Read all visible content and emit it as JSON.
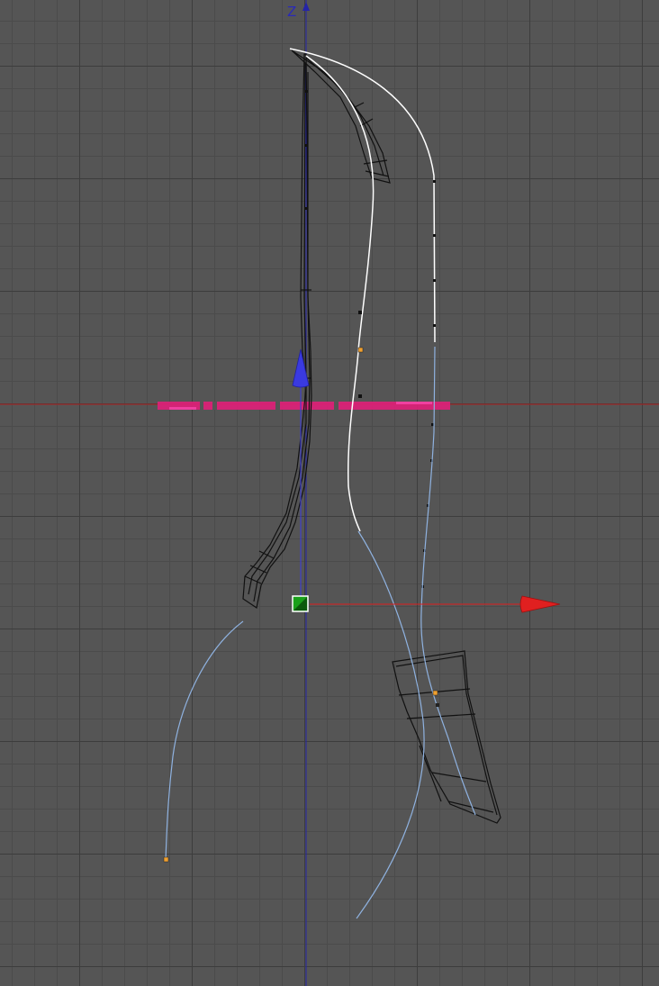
{
  "viewport": {
    "vertical_axis_label": "Z",
    "colors": {
      "background": "#555555",
      "grid_major": "#3d3d3d",
      "grid_minor": "#4b4b4b",
      "world_axis_z": "#2424a8",
      "world_axis_x": "#c82020",
      "gizmo_z": "#3a3ae0",
      "gizmo_x": "#e02020",
      "gizmo_center": "#1aa01a",
      "spline_selected": "#ffffff",
      "spline_unselected": "#8fb2e0",
      "wireframe": "#111111",
      "point_handle": "#f0a030",
      "highlight_strip": "#e0207a"
    }
  }
}
